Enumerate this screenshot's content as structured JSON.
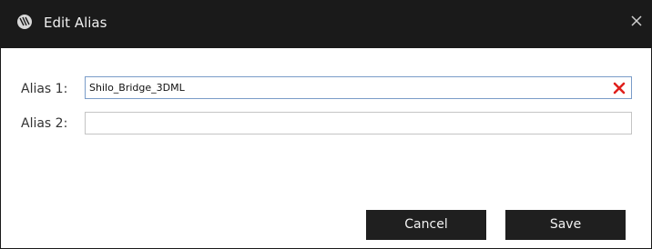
{
  "window": {
    "title": "Edit Alias",
    "icon": "app-logo-icon",
    "close_icon": "close-icon"
  },
  "fields": [
    {
      "label": "Alias 1:",
      "value": "Shilo_Bridge_3DML",
      "clear_icon": "clear-icon",
      "clear_color": "#e0201c"
    },
    {
      "label": "Alias 2:",
      "value": ""
    }
  ],
  "buttons": {
    "cancel": "Cancel",
    "save": "Save"
  },
  "colors": {
    "titlebar": "#1a1a1a",
    "button": "#1f1f1f",
    "focus_border": "#7a9cc8"
  }
}
